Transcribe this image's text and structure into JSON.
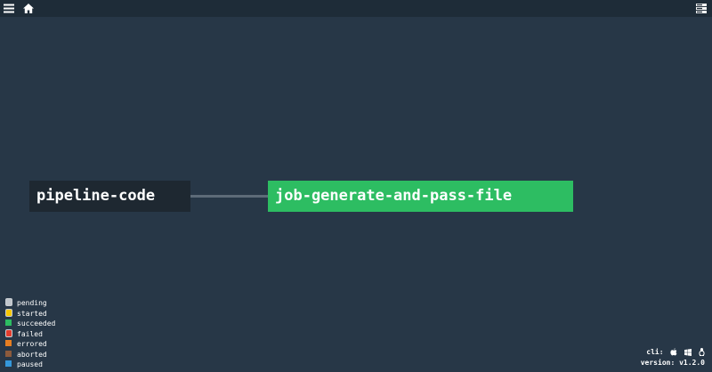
{
  "topbar": {
    "menu_icon": "hamburger-menu-icon",
    "home_icon": "home-icon",
    "groups_icon": "groups-toggle-icon"
  },
  "pipeline": {
    "resource_name": "pipeline-code",
    "job_name": "job-generate-and-pass-file",
    "job_status_color": "#2dbd62"
  },
  "legend": {
    "items": [
      {
        "label": "pending",
        "color": "#c0c6cc",
        "ring": true
      },
      {
        "label": "started",
        "color": "#f6c700",
        "ring": true
      },
      {
        "label": "succeeded",
        "color": "#2dbd62",
        "ring": false
      },
      {
        "label": "failed",
        "color": "#e23c2d",
        "ring": true
      },
      {
        "label": "errored",
        "color": "#e67e22",
        "ring": false
      },
      {
        "label": "aborted",
        "color": "#8b5a3c",
        "ring": false
      },
      {
        "label": "paused",
        "color": "#3498db",
        "ring": false
      }
    ]
  },
  "footer": {
    "cli_label": "cli:",
    "version_label": "version:",
    "version_value": "v1.2.0",
    "cli_icons": [
      "apple-icon",
      "windows-icon",
      "linux-icon"
    ]
  }
}
